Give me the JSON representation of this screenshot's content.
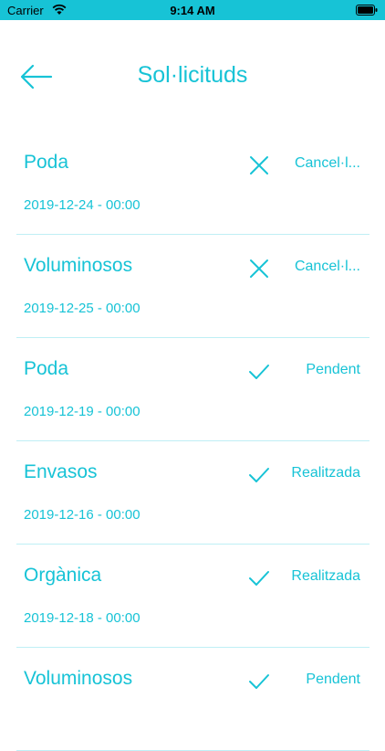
{
  "status_bar": {
    "carrier": "Carrier",
    "time": "9:14 AM"
  },
  "header": {
    "title": "Sol·licituds"
  },
  "colors": {
    "accent": "#17c3d6",
    "divider": "#bfeff5"
  },
  "requests": [
    {
      "name": "Poda",
      "date": "2019-12-24 - 00:00",
      "status": "Cancel·lada",
      "status_display": "Cancel·l...",
      "icon": "close-icon"
    },
    {
      "name": "Voluminosos",
      "date": "2019-12-25 - 00:00",
      "status": "Cancel·lada",
      "status_display": "Cancel·l...",
      "icon": "close-icon"
    },
    {
      "name": "Poda",
      "date": "2019-12-19 - 00:00",
      "status": "Pendent",
      "status_display": "Pendent",
      "icon": "check-icon"
    },
    {
      "name": "Envasos",
      "date": "2019-12-16 - 00:00",
      "status": "Realitzada",
      "status_display": "Realitzada",
      "icon": "check-icon"
    },
    {
      "name": "Orgànica",
      "date": "2019-12-18 - 00:00",
      "status": "Realitzada",
      "status_display": "Realitzada",
      "icon": "check-icon"
    },
    {
      "name": "Voluminosos",
      "date": "",
      "status": "Pendent",
      "status_display": "Pendent",
      "icon": "check-icon"
    }
  ]
}
